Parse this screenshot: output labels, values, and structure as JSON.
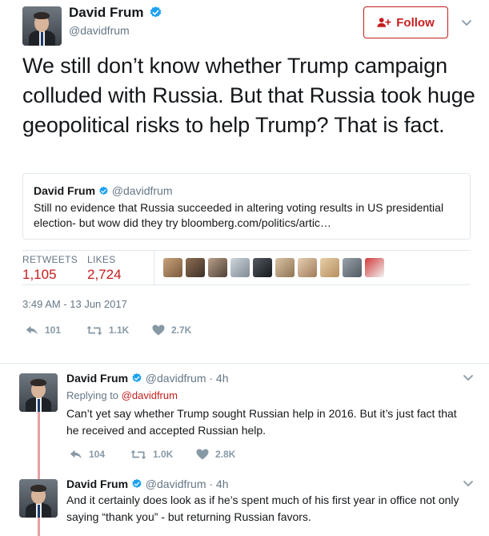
{
  "main": {
    "name": "David Frum",
    "handle": "@davidfrum",
    "follow_label": "Follow",
    "text": "We still don’t know whether Trump campaign colluded with Russia. But that Russia took huge geopolitical risks to help Trump? That is fact.",
    "quote": {
      "name": "David Frum",
      "handle": "@davidfrum",
      "text": "Still no evidence that Russia succeeded in altering voting results in US presidential election- but wow did they try bloomberg.com/politics/artic…"
    },
    "stats": {
      "retweets_label": "RETWEETS",
      "retweets": "1,105",
      "likes_label": "LIKES",
      "likes": "2,724"
    },
    "timestamp": "3:49 AM - 13 Jun 2017",
    "actions": {
      "replies": "101",
      "retweets": "1.1K",
      "likes": "2.7K"
    }
  },
  "replies": [
    {
      "name": "David Frum",
      "handle": "@davidfrum",
      "time": "· 4h",
      "replying_to_label": "Replying to",
      "replying_to": "@davidfrum",
      "text": "Can’t yet say whether Trump sought Russian help in 2016. But it’s just fact that he received and accepted Russian help.",
      "actions": {
        "replies": "104",
        "retweets": "1.0K",
        "likes": "2.8K"
      }
    },
    {
      "name": "David Frum",
      "handle": "@davidfrum",
      "time": "· 4h",
      "text": "And it certainly does look as if he’s spent much of his first year in office not only saying “thank you” - but returning Russian favors."
    }
  ],
  "colors": {
    "accent": "#c51d1d",
    "verified": "#1da1f2",
    "thread": "#e8a0a3"
  },
  "icons": [
    "verified-badge-icon",
    "add-user-icon",
    "chevron-down-icon",
    "reply-icon",
    "retweet-icon",
    "heart-icon"
  ]
}
